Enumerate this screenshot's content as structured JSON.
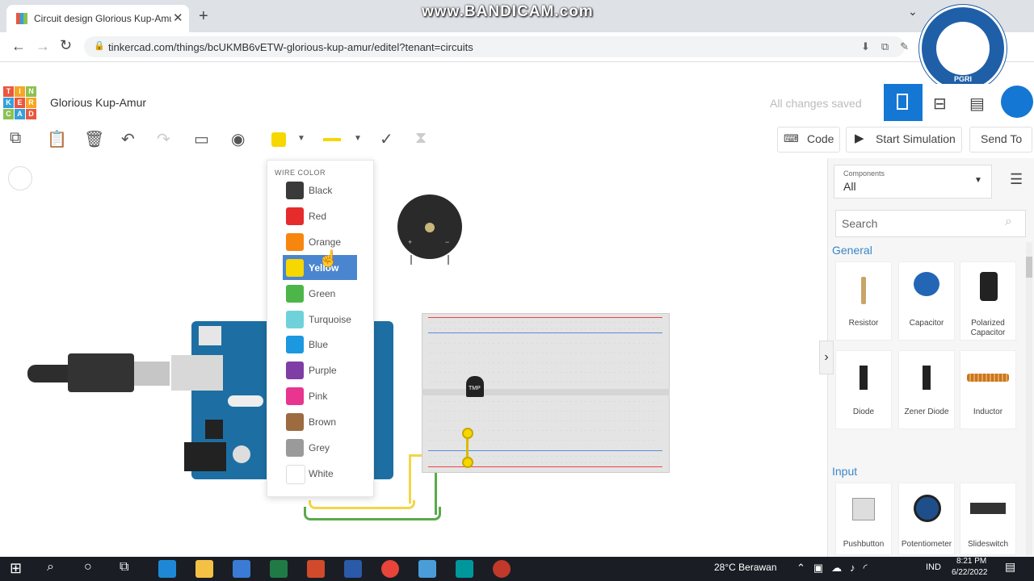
{
  "browser": {
    "tab_title": "Circuit design Glorious Kup-Amur",
    "url": "tinkercad.com/things/bcUKMB6vETW-glorious-kup-amur/editel?tenant=circuits"
  },
  "watermark": "www.BANDICAM.com",
  "seal": {
    "text": "PGRI"
  },
  "app": {
    "design_title": "Glorious Kup-Amur",
    "save_status": "All changes saved"
  },
  "toolbar": {
    "code_label": "Code",
    "start_simulation_label": "Start Simulation",
    "send_to_label": "Send To",
    "current_wire_color": "#f6d700"
  },
  "wire_menu": {
    "title": "WIRE COLOR",
    "items": [
      {
        "label": "Black",
        "color": "#3a3a3a"
      },
      {
        "label": "Red",
        "color": "#e52b2b"
      },
      {
        "label": "Orange",
        "color": "#f7860f"
      },
      {
        "label": "Yellow",
        "color": "#f6d700",
        "selected": true
      },
      {
        "label": "Green",
        "color": "#4cb648"
      },
      {
        "label": "Turquoise",
        "color": "#6fd2db"
      },
      {
        "label": "Blue",
        "color": "#1b98e0"
      },
      {
        "label": "Purple",
        "color": "#7f3ea5"
      },
      {
        "label": "Pink",
        "color": "#e8358f"
      },
      {
        "label": "Brown",
        "color": "#9c6b3f"
      },
      {
        "label": "Grey",
        "color": "#9a9a9a"
      },
      {
        "label": "White",
        "color": "#ffffff"
      }
    ]
  },
  "canvas": {
    "buzzer_plus": "+",
    "buzzer_minus": "−",
    "tmp_label": "TMP"
  },
  "panel": {
    "components_label": "Components",
    "components_value": "All",
    "search_placeholder": "Search",
    "sections": [
      {
        "title": "General",
        "items": [
          "Resistor",
          "Capacitor",
          "Polarized Capacitor",
          "Diode",
          "Zener Diode",
          "Inductor"
        ]
      },
      {
        "title": "Input",
        "items": [
          "Pushbutton",
          "Potentiometer",
          "Slideswitch"
        ]
      }
    ]
  },
  "taskbar": {
    "weather": "28°C  Berawan",
    "language": "IND",
    "time": "8:21 PM",
    "date": "6/22/2022"
  }
}
